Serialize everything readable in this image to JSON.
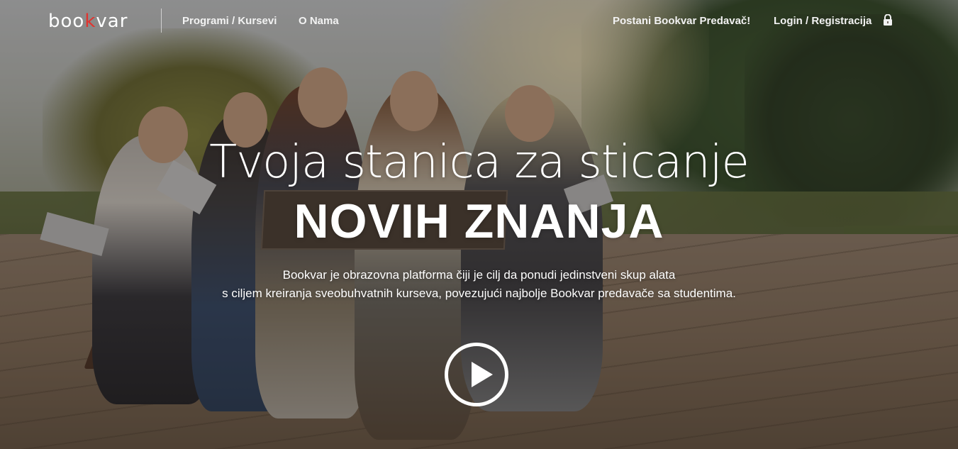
{
  "header": {
    "logo": {
      "part1": "boo",
      "part2": "k",
      "part3": "var"
    },
    "nav": {
      "programs_label": "Programi / Kursevi",
      "about_label": "O Nama",
      "become_teacher_label": "Postani Bookvar Predavač!",
      "login_label": "Login / Registracija"
    },
    "icons": {
      "lock": "lock-icon"
    }
  },
  "hero": {
    "title_line1": "Tvoja stanica za sticanje",
    "title_line2": "NOVIH ZNANJA",
    "description_line1": "Bookvar je obrazovna platforma čiji je cilj da ponudi jedinstveni skup alata",
    "description_line2": "s ciljem kreiranja sveobuhvatnih kurseva, povezujući najbolje Bookvar predavače sa studentima.",
    "play_icon": "play-icon"
  },
  "colors": {
    "logo_accent": "#e1342f",
    "text": "#ffffff",
    "overlay": "rgba(35,30,28,0.42)"
  }
}
